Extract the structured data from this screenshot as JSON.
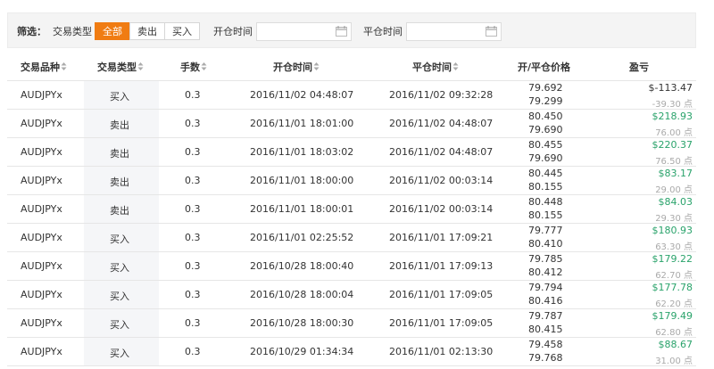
{
  "filter": {
    "label": "筛选：",
    "type_label": "交易类型",
    "buttons": [
      "全部",
      "卖出",
      "买入"
    ],
    "open_time_label": "开仓时间",
    "close_time_label": "平仓时间",
    "open_time_value": "",
    "close_time_value": ""
  },
  "headers": [
    "交易品种",
    "交易类型",
    "手数",
    "开仓时间",
    "平仓时间",
    "开/平仓价格",
    "盈亏"
  ],
  "rows": [
    {
      "symbol": "AUDJPYx",
      "type": "买入",
      "lots": "0.3",
      "open_time": "2016/11/02 04:48:07",
      "close_time": "2016/11/02 09:32:28",
      "open_price": "79.692",
      "close_price": "79.299",
      "profit": "$-113.47",
      "points": "-39.30 点",
      "positive": false
    },
    {
      "symbol": "AUDJPYx",
      "type": "卖出",
      "lots": "0.3",
      "open_time": "2016/11/01 18:01:00",
      "close_time": "2016/11/02 04:48:07",
      "open_price": "80.450",
      "close_price": "79.690",
      "profit": "$218.93",
      "points": "76.00 点",
      "positive": true
    },
    {
      "symbol": "AUDJPYx",
      "type": "卖出",
      "lots": "0.3",
      "open_time": "2016/11/01 18:03:02",
      "close_time": "2016/11/02 04:48:07",
      "open_price": "80.455",
      "close_price": "79.690",
      "profit": "$220.37",
      "points": "76.50 点",
      "positive": true
    },
    {
      "symbol": "AUDJPYx",
      "type": "卖出",
      "lots": "0.3",
      "open_time": "2016/11/01 18:00:00",
      "close_time": "2016/11/02 00:03:14",
      "open_price": "80.445",
      "close_price": "80.155",
      "profit": "$83.17",
      "points": "29.00 点",
      "positive": true
    },
    {
      "symbol": "AUDJPYx",
      "type": "卖出",
      "lots": "0.3",
      "open_time": "2016/11/01 18:00:01",
      "close_time": "2016/11/02 00:03:14",
      "open_price": "80.448",
      "close_price": "80.155",
      "profit": "$84.03",
      "points": "29.30 点",
      "positive": true
    },
    {
      "symbol": "AUDJPYx",
      "type": "买入",
      "lots": "0.3",
      "open_time": "2016/11/01 02:25:52",
      "close_time": "2016/11/01 17:09:21",
      "open_price": "79.777",
      "close_price": "80.410",
      "profit": "$180.93",
      "points": "63.30 点",
      "positive": true
    },
    {
      "symbol": "AUDJPYx",
      "type": "买入",
      "lots": "0.3",
      "open_time": "2016/10/28 18:00:40",
      "close_time": "2016/11/01 17:09:13",
      "open_price": "79.785",
      "close_price": "80.412",
      "profit": "$179.22",
      "points": "62.70 点",
      "positive": true
    },
    {
      "symbol": "AUDJPYx",
      "type": "买入",
      "lots": "0.3",
      "open_time": "2016/10/28 18:00:04",
      "close_time": "2016/11/01 17:09:05",
      "open_price": "79.794",
      "close_price": "80.416",
      "profit": "$177.78",
      "points": "62.20 点",
      "positive": true
    },
    {
      "symbol": "AUDJPYx",
      "type": "买入",
      "lots": "0.3",
      "open_time": "2016/10/28 18:00:30",
      "close_time": "2016/11/01 17:09:05",
      "open_price": "79.787",
      "close_price": "80.415",
      "profit": "$179.49",
      "points": "62.80 点",
      "positive": true
    },
    {
      "symbol": "AUDJPYx",
      "type": "买入",
      "lots": "0.3",
      "open_time": "2016/10/29 01:34:34",
      "close_time": "2016/11/01 02:13:30",
      "open_price": "79.458",
      "close_price": "79.768",
      "profit": "$88.67",
      "points": "31.00 点",
      "positive": true
    }
  ],
  "colors": {
    "accent": "#f07c12",
    "profit_positive": "#2aa36b",
    "points_text": "#aaaaaa"
  }
}
